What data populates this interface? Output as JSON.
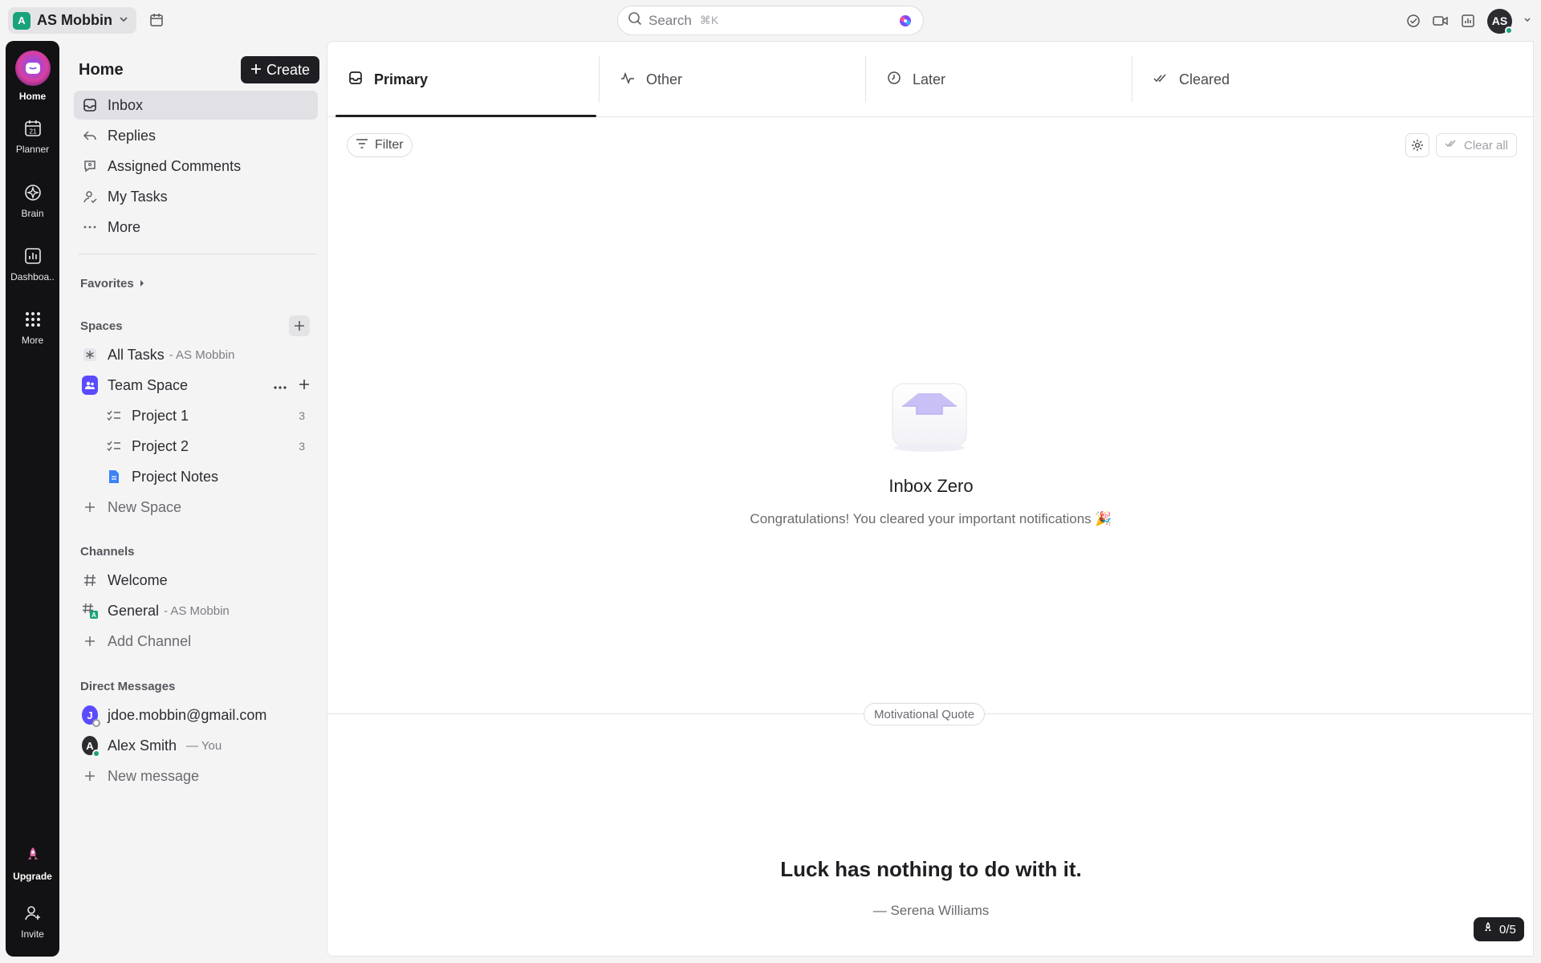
{
  "topbar": {
    "workspace_initial": "A",
    "workspace_name": "AS Mobbin",
    "search_placeholder": "Search",
    "search_shortcut": "⌘K",
    "user_initials": "AS"
  },
  "rail": {
    "items": [
      {
        "label": "Home",
        "icon": "home-icon"
      },
      {
        "label": "Planner",
        "icon": "calendar-icon"
      },
      {
        "label": "Brain",
        "icon": "brain-icon"
      },
      {
        "label": "Dashboa..",
        "icon": "dashboard-icon"
      },
      {
        "label": "More",
        "icon": "grid-icon"
      }
    ],
    "upgrade_label": "Upgrade",
    "invite_label": "Invite",
    "planner_day": "21"
  },
  "sidebar": {
    "title": "Home",
    "create_label": "Create",
    "nav": [
      {
        "label": "Inbox",
        "icon": "inbox-icon",
        "active": true
      },
      {
        "label": "Replies",
        "icon": "reply-icon"
      },
      {
        "label": "Assigned Comments",
        "icon": "comment-icon"
      },
      {
        "label": "My Tasks",
        "icon": "user-task-icon"
      },
      {
        "label": "More",
        "icon": "more-dots-icon"
      }
    ],
    "favorites_label": "Favorites",
    "spaces_label": "Spaces",
    "all_tasks": {
      "label": "All Tasks",
      "sub": "- AS Mobbin"
    },
    "team_space": "Team Space",
    "projects": [
      {
        "label": "Project 1",
        "count": "3"
      },
      {
        "label": "Project 2",
        "count": "3"
      },
      {
        "label": "Project Notes",
        "count": ""
      }
    ],
    "new_space": "New Space",
    "channels_label": "Channels",
    "channels": [
      {
        "label": "Welcome",
        "sub": ""
      },
      {
        "label": "General",
        "sub": "- AS Mobbin"
      }
    ],
    "add_channel": "Add Channel",
    "dm_label": "Direct Messages",
    "dms": [
      {
        "label": "jdoe.mobbin@gmail.com",
        "initial": "J",
        "suffix": ""
      },
      {
        "label": "Alex Smith",
        "initial": "A",
        "suffix": "— You"
      }
    ],
    "new_message": "New message"
  },
  "main": {
    "tabs": [
      {
        "label": "Primary",
        "icon": "inbox-icon",
        "active": true
      },
      {
        "label": "Other",
        "icon": "activity-icon"
      },
      {
        "label": "Later",
        "icon": "clock-icon"
      },
      {
        "label": "Cleared",
        "icon": "double-check-icon"
      }
    ],
    "filter_label": "Filter",
    "clear_all_label": "Clear all",
    "empty_title": "Inbox Zero",
    "empty_subtitle": "Congratulations! You cleared your important notifications 🎉",
    "quote_pill": "Motivational Quote",
    "quote_text": "Luck has nothing to do with it.",
    "quote_author": "— Serena Williams",
    "progress_label": "0/5"
  },
  "colors": {
    "accent": "#1f1f23",
    "brand_green": "#1aa37a",
    "team_purple": "#5b4bff"
  }
}
